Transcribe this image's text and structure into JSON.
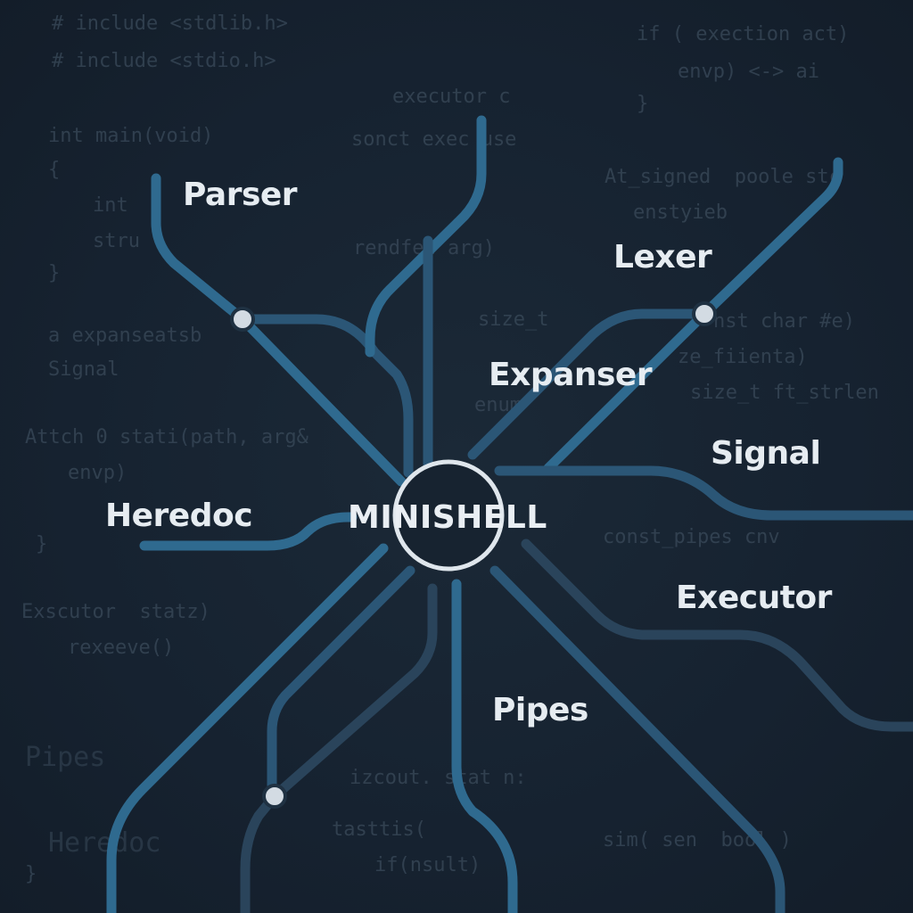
{
  "hub": {
    "label": "MINISHELL"
  },
  "nodes": [
    {
      "id": "parser",
      "label": "Parser"
    },
    {
      "id": "lexer",
      "label": "Lexer"
    },
    {
      "id": "expanser",
      "label": "Expanser"
    },
    {
      "id": "signal",
      "label": "Signal"
    },
    {
      "id": "heredoc",
      "label": "Heredoc"
    },
    {
      "id": "executor",
      "label": "Executor"
    },
    {
      "id": "pipes",
      "label": "Pipes"
    }
  ],
  "background_code": [
    "# include <stdlib.h>",
    "# include <stdio.h>",
    "int main(void)",
    "{",
    "int",
    "stru",
    "}",
    "a expanseatsb",
    "Signal",
    "Attch 0 stati(path, arg&",
    "envp)",
    "}",
    "Exscutor  statz)",
    "rexeeve()",
    "Pipes",
    "Heredoc",
    "}",
    "executor c",
    "sonct exec use",
    "rendfen arg)",
    "size_t",
    "if ( exection act)",
    "envp) <-> ai",
    "}",
    "At_signed  poole stc",
    "enstyieb",
    "nst char #e)",
    "ze_fiienta)",
    "size_t ft_strlen",
    "enum",
    "const_pipes cnv",
    "izcout. stat n:",
    "tasttis(",
    "if(nsult)",
    "sim( sen  bool )"
  ],
  "colors": {
    "background": "#172330",
    "route_primary": "#2f6a8f",
    "route_secondary": "#2b5676",
    "route_dim": "#2a445b",
    "station_fill": "#d3dbe3",
    "label_text": "#e6ecf1",
    "code_text": "#3a4a5a"
  }
}
